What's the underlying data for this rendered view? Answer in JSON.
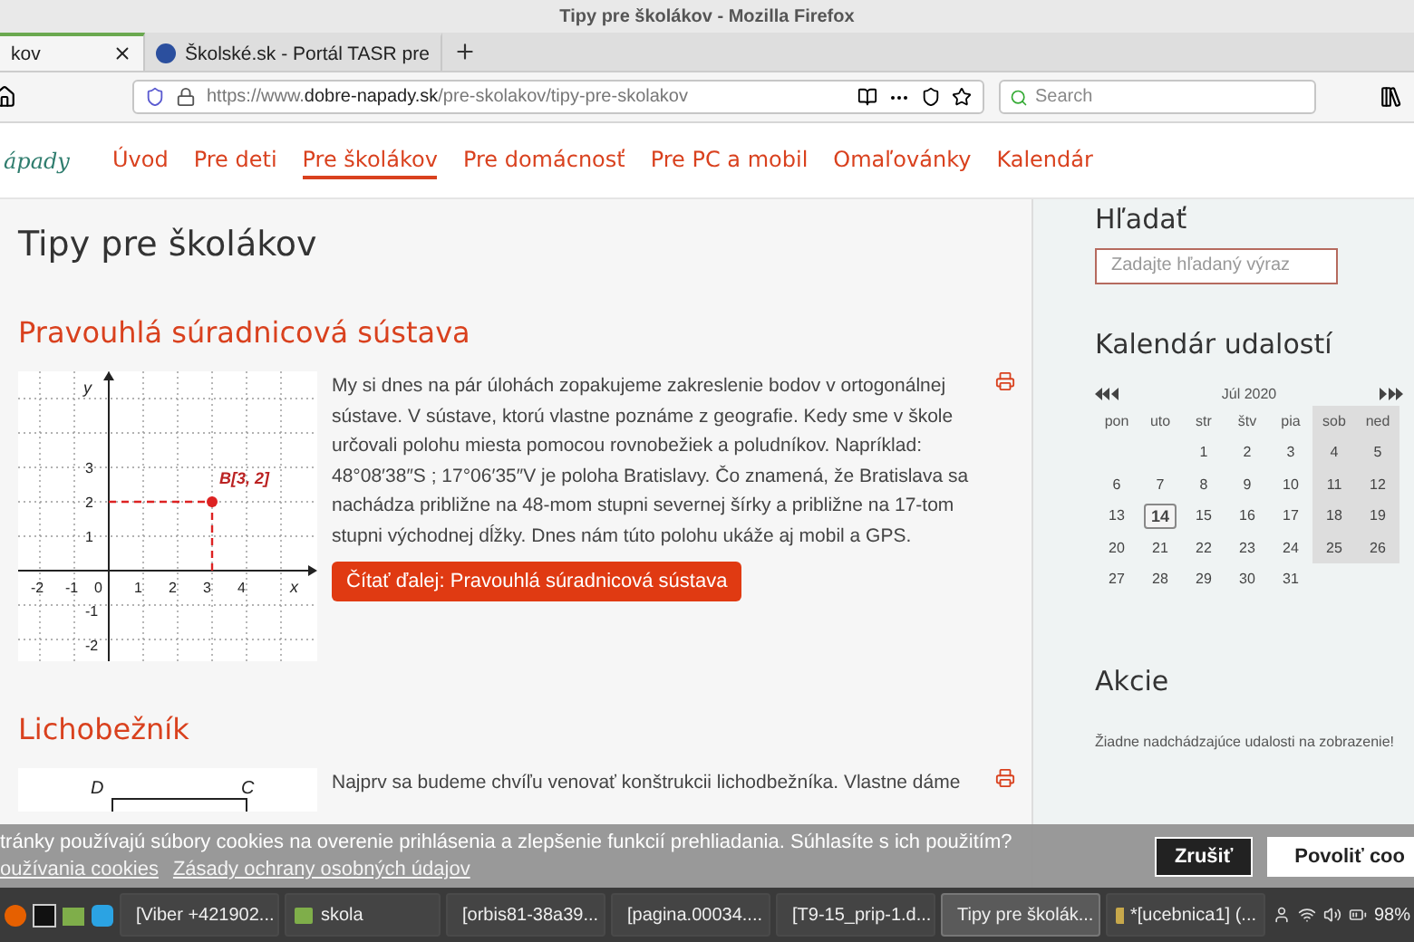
{
  "window": {
    "title": "Tipy pre školákov - Mozilla Firefox"
  },
  "tabs": [
    {
      "label": "kov",
      "selected": true
    },
    {
      "label": "Školské.sk - Portál TASR pre",
      "selected": false
    }
  ],
  "address_bar": {
    "url_prefix": "https://www.",
    "url_domain": "dobre-napady.sk",
    "url_path": "/pre-skolakov/tipy-pre-skolakov"
  },
  "search": {
    "placeholder": "Search"
  },
  "site": {
    "logo": "ápady",
    "nav": [
      {
        "label": "Úvod",
        "selected": false
      },
      {
        "label": "Pre deti",
        "selected": false
      },
      {
        "label": "Pre školákov",
        "selected": true
      },
      {
        "label": "Pre domácnosť",
        "selected": false
      },
      {
        "label": "Pre PC a mobil",
        "selected": false
      },
      {
        "label": "Omaľovánky",
        "selected": false
      },
      {
        "label": "Kalendár",
        "selected": false
      }
    ]
  },
  "page_title": "Tipy pre školákov",
  "articles": [
    {
      "title": "Pravouhlá súradnicová sústava",
      "kind": "graph",
      "graph": {
        "axis_x": "x",
        "axis_y": "y",
        "x_ticks": [
          "-2",
          "-1",
          "0",
          "1",
          "2",
          "3",
          "4"
        ],
        "y_ticks": [
          "3",
          "2",
          "1",
          "-1",
          "-2"
        ],
        "point_label": "B[3, 2]"
      },
      "text": "My si dnes na pár úlohách zopakujeme zakreslenie bodov v ortogonálnej sústave. V sústave, ktorú vlastne poznáme z geografie. Kedy sme v škole určovali polohu miesta pomocou rovnobežiek a poludníkov. Napríklad: 48°08′38″S ; 17°06′35″V je poloha Bratislavy. Čo znamená, že Bratislava sa nachádza približne na 48-mom stupni severnej šírky a približne na 17-tom stupni východnej dĺžky. Dnes nám túto polohu ukáže aj mobil a GPS.",
      "read_more": "Čítať ďalej: Pravouhlá súradnicová sústava"
    },
    {
      "title": "Lichobežník",
      "kind": "trapezoid",
      "graph": {
        "vertex_left": "D",
        "vertex_right": "C"
      },
      "text": "Najprv sa budeme chvíľu venovať konštrukcii lichodbežníka. Vlastne dáme"
    }
  ],
  "sidebar": {
    "search_heading": "Hľadať",
    "search_placeholder": "Zadajte hľadaný výraz",
    "calendar_heading": "Kalendár udalostí",
    "calendar": {
      "month": "Júl 2020",
      "weekdays": [
        "pon",
        "uto",
        "str",
        "štv",
        "pia",
        "sob",
        "ned"
      ],
      "weeks": [
        [
          {
            "day": "1",
            "selected": false
          },
          {
            "day": "2",
            "selected": false
          },
          {
            "day": "3",
            "selected": false
          },
          {
            "day": "4",
            "selected": false
          },
          {
            "day": "5",
            "selected": false
          }
        ],
        [
          {
            "day": "6",
            "selected": false
          },
          {
            "day": "7",
            "selected": false
          },
          {
            "day": "8",
            "selected": false
          },
          {
            "day": "9",
            "selected": false
          },
          {
            "day": "10",
            "selected": false
          },
          {
            "day": "11",
            "selected": false
          },
          {
            "day": "12",
            "selected": false
          }
        ],
        [
          {
            "day": "13",
            "selected": false
          },
          {
            "day": "14",
            "selected": true
          },
          {
            "day": "15",
            "selected": false
          },
          {
            "day": "16",
            "selected": false
          },
          {
            "day": "17",
            "selected": false
          },
          {
            "day": "18",
            "selected": false
          },
          {
            "day": "19",
            "selected": false
          }
        ],
        [
          {
            "day": "20",
            "selected": false
          },
          {
            "day": "21",
            "selected": false
          },
          {
            "day": "22",
            "selected": false
          },
          {
            "day": "23",
            "selected": false
          },
          {
            "day": "24",
            "selected": false
          },
          {
            "day": "25",
            "selected": false
          },
          {
            "day": "26",
            "selected": false
          }
        ],
        [
          {
            "day": "27",
            "selected": false
          },
          {
            "day": "28",
            "selected": false
          },
          {
            "day": "29",
            "selected": false
          },
          {
            "day": "30",
            "selected": false
          },
          {
            "day": "31",
            "selected": false
          }
        ]
      ]
    },
    "events_heading": "Akcie",
    "events_empty": "Žiadne nadchádzajúce udalosti na zobrazenie!"
  },
  "cookie_bar": {
    "text": "tránky používajú súbory cookies na overenie prihlásenia a zlepšenie funkcií prehliadania. Súhlasíte s ich použitím?",
    "links": [
      "oužívania cookies",
      "Zásady ochrany osobných údajov"
    ],
    "buttons": [
      {
        "label": "Zrušiť",
        "kind": "dark"
      },
      {
        "label": "Povoliť coo",
        "kind": "light"
      }
    ]
  },
  "taskbar": {
    "items": [
      {
        "label": "[Viber +421902...",
        "kind": "viber",
        "selected": false
      },
      {
        "label": "skola",
        "kind": "folder",
        "selected": false
      },
      {
        "label": "[orbis81-38a39...",
        "kind": "image",
        "selected": false
      },
      {
        "label": "[pagina.00034....",
        "kind": "image",
        "selected": false
      },
      {
        "label": "[T9-15_prip-1.d...",
        "kind": "document",
        "selected": false
      },
      {
        "label": "Tipy pre školák...",
        "kind": "browser",
        "selected": true
      },
      {
        "label": "*[ucebnica1] (...",
        "kind": "editor",
        "selected": false
      }
    ],
    "battery": "98%"
  }
}
